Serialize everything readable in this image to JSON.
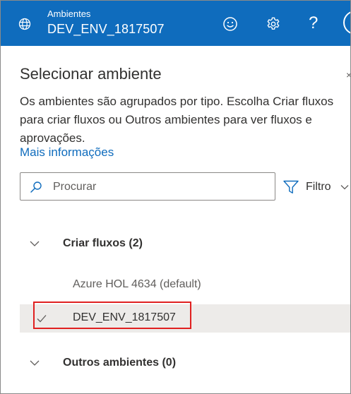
{
  "header": {
    "environment_caption": "Ambientes",
    "environment_name": "DEV_ENV_1817507",
    "help_label": "?",
    "icons": [
      "globe-icon",
      "smiley-icon",
      "gear-icon",
      "help-icon",
      "avatar"
    ],
    "background": "#0f6cbd"
  },
  "panel": {
    "title": "Selecionar ambiente",
    "close_label": "×",
    "description": "Os ambientes são agrupados por tipo. Escolha Criar fluxos para criar fluxos ou Outros ambientes para ver fluxos e aprovações.",
    "more_info_link": "Mais informações",
    "search": {
      "placeholder": "Procurar",
      "value": ""
    },
    "filter": {
      "label": "Filtro"
    }
  },
  "groups": [
    {
      "label": "Criar fluxos (2)",
      "expanded": true,
      "items": [
        {
          "label": "Azure HOL 4634 (default)",
          "selected": false
        },
        {
          "label": "DEV_ENV_1817507",
          "selected": true,
          "highlighted": true
        }
      ]
    },
    {
      "label": "Outros ambientes (0)",
      "expanded": true,
      "items": []
    }
  ],
  "colors": {
    "accent": "#0f6cbd",
    "selected_row": "#edebe9",
    "highlight_box": "#e02020"
  }
}
